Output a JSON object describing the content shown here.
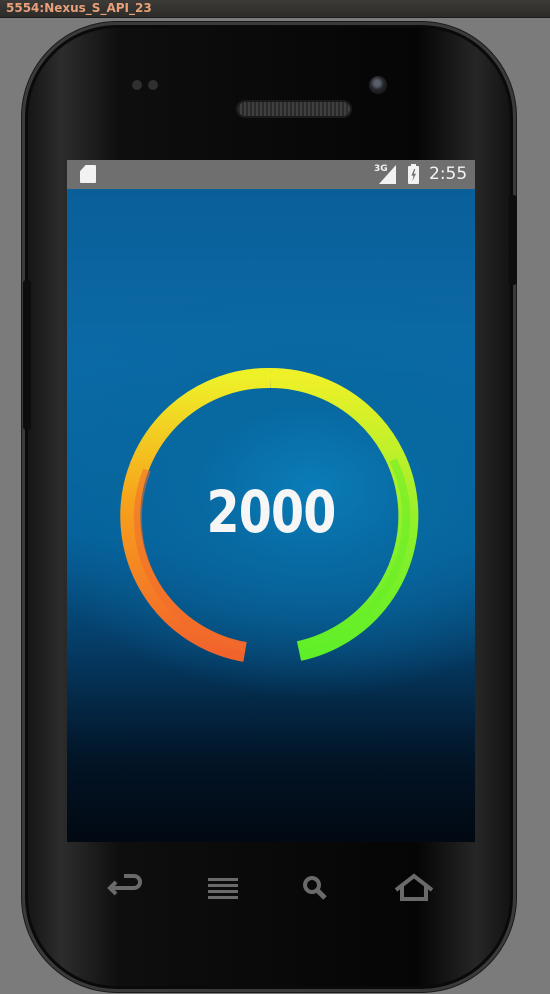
{
  "window": {
    "title": "5554:Nexus_S_API_23"
  },
  "status_bar": {
    "network_type": "3G",
    "time": "2:55",
    "icons": [
      "sd-card-icon",
      "signal-icon",
      "battery-charging-icon"
    ]
  },
  "gauge": {
    "value": "2000",
    "colors": {
      "start": "#f2632c",
      "orange": "#f7a21b",
      "top": "#eef028",
      "end": "#5fef28"
    }
  },
  "nav_bar": {
    "buttons": [
      "back-icon",
      "menu-icon",
      "search-icon",
      "home-icon"
    ]
  }
}
